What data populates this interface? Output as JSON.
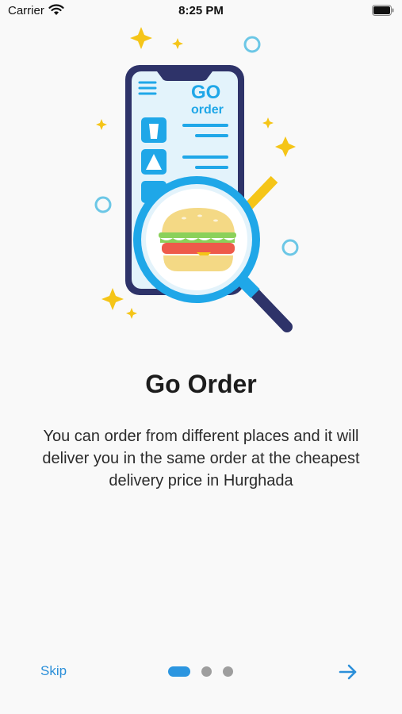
{
  "status_bar": {
    "carrier": "Carrier",
    "time": "8:25 PM"
  },
  "illustration": {
    "brand_text_go": "GO",
    "brand_text_order": "order"
  },
  "onboarding": {
    "title": "Go Order",
    "description": "You can order from different places and it will deliver you in the same order at the cheapest delivery price in Hurghada"
  },
  "footer": {
    "skip_label": "Skip",
    "pages": 3,
    "active_page": 1
  },
  "colors": {
    "accent": "#2b8fd9",
    "magnifier": "#1fa7e8",
    "phone_frame": "#2e3369",
    "check": "#f5c518"
  },
  "icons": {
    "wifi": "wifi-icon",
    "battery": "battery-icon",
    "next": "arrow-right-icon"
  }
}
